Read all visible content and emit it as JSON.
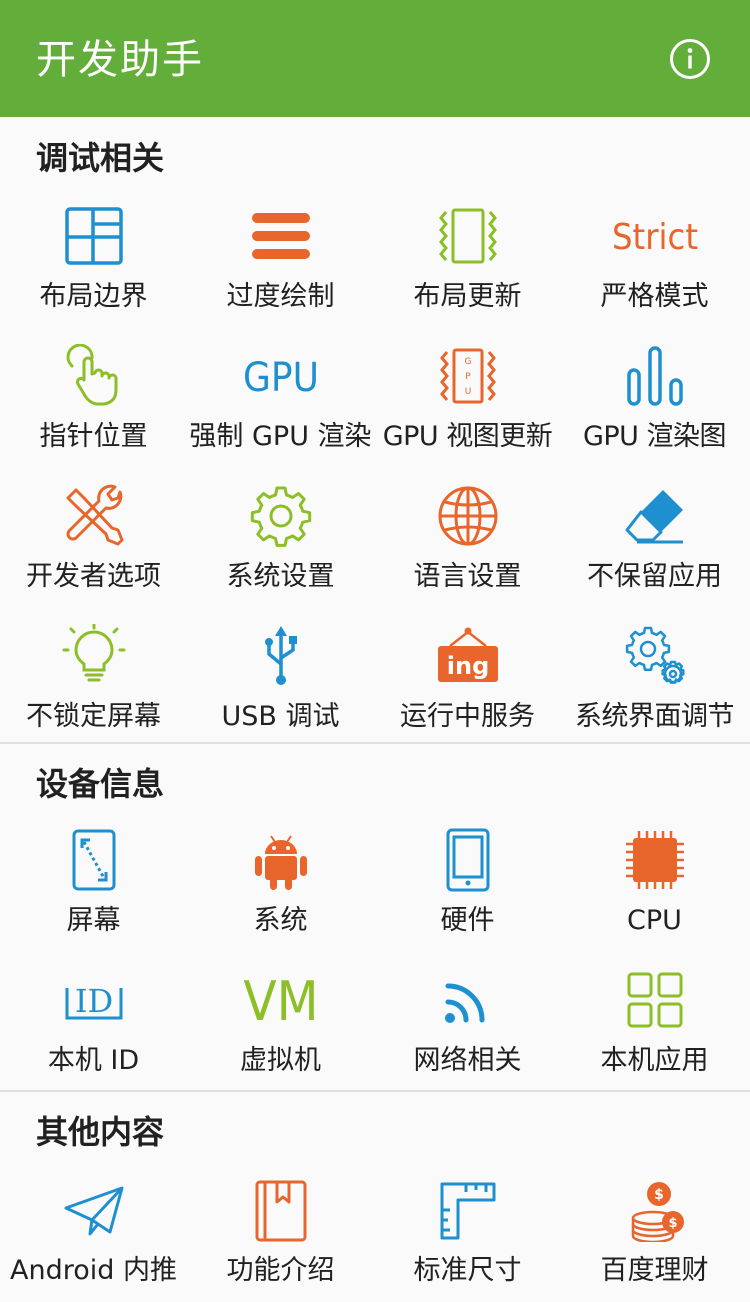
{
  "app": {
    "title": "开发助手",
    "accent": "#63ad3a"
  },
  "colors": {
    "blue": "#1f90cf",
    "orange": "#e8652c",
    "green": "#8cbf27"
  },
  "sections": [
    {
      "title": "调试相关",
      "items": [
        {
          "label": "布局边界",
          "icon": "layout-bounds-icon"
        },
        {
          "label": "过度绘制",
          "icon": "overdraw-icon"
        },
        {
          "label": "布局更新",
          "icon": "layout-update-icon"
        },
        {
          "label": "严格模式",
          "icon": "strict-mode-icon",
          "icon_text": "Strict"
        },
        {
          "label": "指针位置",
          "icon": "pointer-location-icon"
        },
        {
          "label": "强制 GPU 渲染",
          "icon": "gpu-icon",
          "icon_text": "GPU"
        },
        {
          "label": "GPU 视图更新",
          "icon": "gpu-view-update-icon",
          "icon_text": "GPU"
        },
        {
          "label": "GPU 渲染图",
          "icon": "gpu-render-bars-icon"
        },
        {
          "label": "开发者选项",
          "icon": "tools-icon"
        },
        {
          "label": "系统设置",
          "icon": "gear-icon"
        },
        {
          "label": "语言设置",
          "icon": "globe-icon"
        },
        {
          "label": "不保留应用",
          "icon": "eraser-icon"
        },
        {
          "label": "不锁定屏幕",
          "icon": "lightbulb-icon"
        },
        {
          "label": "USB 调试",
          "icon": "usb-icon"
        },
        {
          "label": "运行中服务",
          "icon": "running-service-icon",
          "icon_text": "ing"
        },
        {
          "label": "系统界面调节",
          "icon": "system-ui-gears-icon"
        }
      ]
    },
    {
      "title": "设备信息",
      "items": [
        {
          "label": "屏幕",
          "icon": "screen-icon"
        },
        {
          "label": "系统",
          "icon": "android-icon"
        },
        {
          "label": "硬件",
          "icon": "phone-hardware-icon"
        },
        {
          "label": "CPU",
          "icon": "cpu-chip-icon"
        },
        {
          "label": "本机 ID",
          "icon": "id-icon",
          "icon_text": "ID"
        },
        {
          "label": "虚拟机",
          "icon": "vm-icon",
          "icon_text": "VM"
        },
        {
          "label": "网络相关",
          "icon": "network-signal-icon"
        },
        {
          "label": "本机应用",
          "icon": "apps-grid-icon"
        }
      ]
    },
    {
      "title": "其他内容",
      "items": [
        {
          "label": "Android 内推",
          "icon": "paper-plane-icon"
        },
        {
          "label": "功能介绍",
          "icon": "book-icon"
        },
        {
          "label": "标准尺寸",
          "icon": "ruler-icon"
        },
        {
          "label": "百度理财",
          "icon": "coins-icon",
          "icon_text": "$"
        }
      ]
    }
  ]
}
